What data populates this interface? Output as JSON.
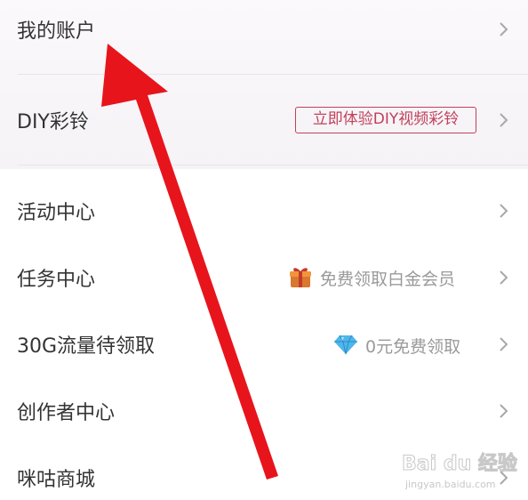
{
  "menu": {
    "my_account": "我的账户",
    "diy_ringtone": "DIY彩铃",
    "diy_badge": "立即体验DIY视频彩铃",
    "activity_center": "活动中心",
    "task_center": "任务中心",
    "task_hint": "免费领取白金会员",
    "data_bonus": "30G流量待领取",
    "data_hint": "0元免费领取",
    "creator_center": "创作者中心",
    "migu_mall": "咪咕商城"
  },
  "icons": {
    "gift": "gift-icon",
    "diamond": "diamond-icon",
    "chevron": "chevron-right-icon"
  },
  "colors": {
    "badge": "#c2405a",
    "arrow": "#e8141c",
    "hint": "#9a9a9a"
  },
  "watermark": {
    "brand": "Bai du 经验",
    "url": "jingyan.baidu.com"
  }
}
